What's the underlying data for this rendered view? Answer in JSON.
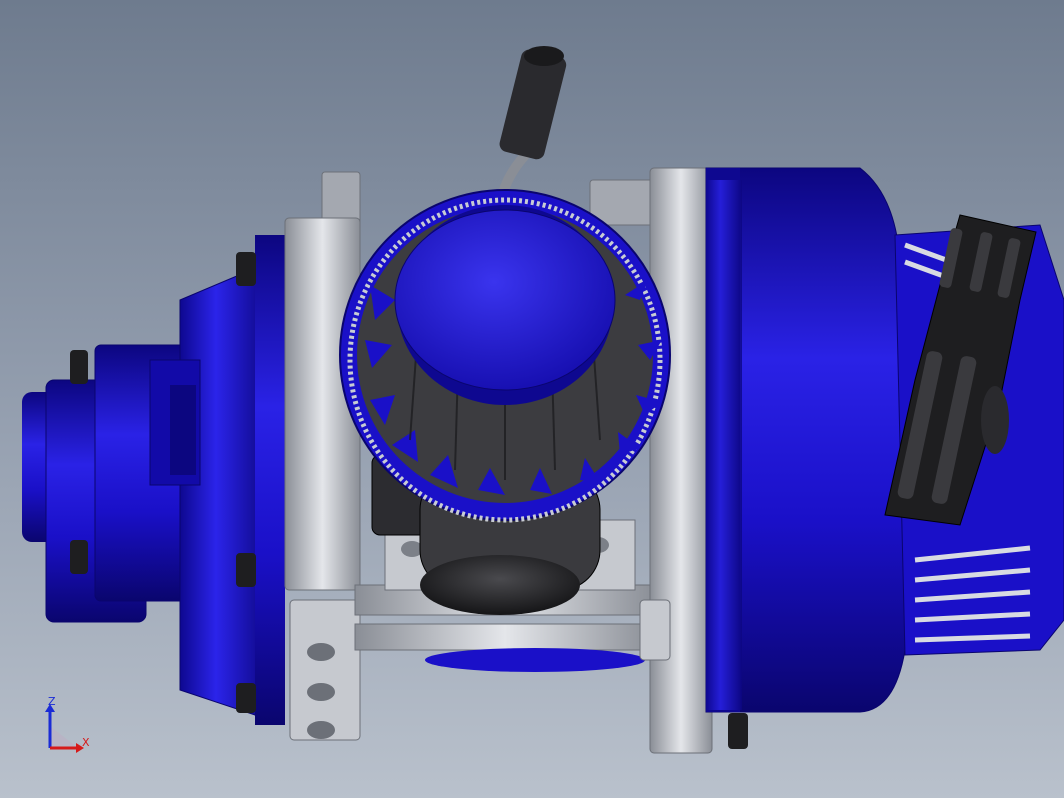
{
  "viewport": {
    "background_top": "#6e7b8e",
    "background_bottom": "#b9c1cc"
  },
  "model": {
    "colors": {
      "blue": "#1a10c8",
      "blue_dark": "#0c0680",
      "blue_light": "#3a34ee",
      "metal": "#b8bcc4",
      "metal_dark": "#7c8088",
      "black": "#1e1e20"
    }
  },
  "triad": {
    "z_label": "Z",
    "x_label": "X",
    "z_color": "#1a2bd6",
    "x_color": "#d61a1a"
  }
}
